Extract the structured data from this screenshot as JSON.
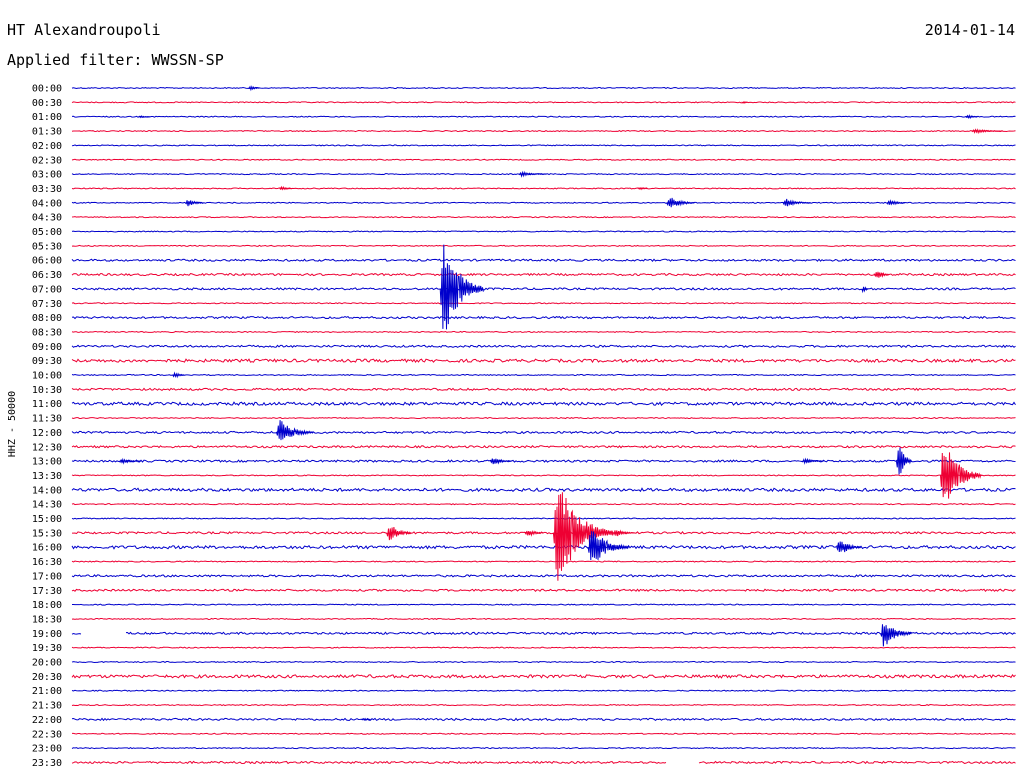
{
  "header": {
    "station": "HT Alexandroupoli",
    "date": "2014-01-14",
    "filter_text": "Applied filter: WWSSN-SP"
  },
  "chart_data": {
    "type": "seismogram",
    "ylabel": "HHZ - 50000",
    "colors": [
      "#0000cc",
      "#ee0033"
    ],
    "rows": [
      "00:00",
      "00:30",
      "01:00",
      "01:30",
      "02:00",
      "02:30",
      "03:00",
      "03:30",
      "04:00",
      "04:30",
      "05:00",
      "05:30",
      "06:00",
      "06:30",
      "07:00",
      "07:30",
      "08:00",
      "08:30",
      "09:00",
      "09:30",
      "10:00",
      "10:30",
      "11:00",
      "11:30",
      "12:00",
      "12:30",
      "13:00",
      "13:30",
      "14:00",
      "14:30",
      "15:00",
      "15:30",
      "16:00",
      "16:30",
      "17:00",
      "17:30",
      "18:00",
      "18:30",
      "19:00",
      "19:30",
      "20:00",
      "20:30",
      "21:00",
      "21:30",
      "22:00",
      "22:30",
      "23:00",
      "23:30"
    ],
    "row_noise": [
      1,
      1,
      1,
      1,
      1,
      1,
      1,
      1,
      1,
      1,
      1,
      1,
      2,
      2,
      2,
      1,
      2,
      1,
      2,
      3,
      1,
      2,
      3,
      1,
      2,
      2,
      2,
      1,
      3,
      1,
      1,
      2,
      3,
      1,
      2,
      2,
      1,
      1,
      2,
      1,
      1,
      3,
      1,
      1,
      2,
      1,
      1,
      2
    ],
    "gaps": [
      {
        "row": 38,
        "from_min": 0.3,
        "to_min": 1.7
      },
      {
        "row": 47,
        "from_min": 18.9,
        "to_min": 19.9
      }
    ],
    "events": [
      {
        "row": 0,
        "at_min": 5.6,
        "amp": 4,
        "dur_min": 0.4
      },
      {
        "row": 1,
        "at_min": 21.3,
        "amp": 3,
        "dur_min": 0.2
      },
      {
        "row": 2,
        "at_min": 2.1,
        "amp": 2,
        "dur_min": 0.4
      },
      {
        "row": 2,
        "at_min": 28.4,
        "amp": 4,
        "dur_min": 0.4
      },
      {
        "row": 3,
        "at_min": 28.6,
        "amp": 3,
        "dur_min": 1.0
      },
      {
        "row": 6,
        "at_min": 14.2,
        "amp": 3,
        "dur_min": 0.9
      },
      {
        "row": 7,
        "at_min": 6.6,
        "amp": 4,
        "dur_min": 0.4
      },
      {
        "row": 7,
        "at_min": 18.0,
        "amp": 4,
        "dur_min": 0.3
      },
      {
        "row": 8,
        "at_min": 3.6,
        "amp": 6,
        "dur_min": 0.6
      },
      {
        "row": 8,
        "at_min": 18.9,
        "amp": 10,
        "dur_min": 0.9
      },
      {
        "row": 8,
        "at_min": 22.6,
        "amp": 6,
        "dur_min": 0.9
      },
      {
        "row": 8,
        "at_min": 25.9,
        "amp": 5,
        "dur_min": 0.6
      },
      {
        "row": 13,
        "at_min": 25.5,
        "amp": 8,
        "dur_min": 0.5
      },
      {
        "row": 14,
        "at_min": 11.7,
        "amp": 66,
        "dur_min": 1.4
      },
      {
        "row": 14,
        "at_min": 25.1,
        "amp": 14,
        "dur_min": 0.2
      },
      {
        "row": 20,
        "at_min": 3.2,
        "amp": 6,
        "dur_min": 0.4
      },
      {
        "row": 24,
        "at_min": 6.5,
        "amp": 18,
        "dur_min": 1.2
      },
      {
        "row": 26,
        "at_min": 1.5,
        "amp": 4,
        "dur_min": 0.7
      },
      {
        "row": 26,
        "at_min": 13.3,
        "amp": 6,
        "dur_min": 0.7
      },
      {
        "row": 26,
        "at_min": 23.2,
        "amp": 4,
        "dur_min": 0.7
      },
      {
        "row": 26,
        "at_min": 26.2,
        "amp": 33,
        "dur_min": 0.5
      },
      {
        "row": 27,
        "at_min": 27.6,
        "amp": 48,
        "dur_min": 1.3
      },
      {
        "row": 31,
        "at_min": 10.0,
        "amp": 15,
        "dur_min": 0.8
      },
      {
        "row": 31,
        "at_min": 14.4,
        "amp": 6,
        "dur_min": 0.6
      },
      {
        "row": 31,
        "at_min": 17.2,
        "amp": 6,
        "dur_min": 0.7
      },
      {
        "row": 31,
        "at_min": 15.3,
        "amp": 70,
        "dur_min": 1.9
      },
      {
        "row": 32,
        "at_min": 16.4,
        "amp": 28,
        "dur_min": 1.3
      },
      {
        "row": 32,
        "at_min": 24.3,
        "amp": 14,
        "dur_min": 0.8
      },
      {
        "row": 38,
        "at_min": 25.7,
        "amp": 22,
        "dur_min": 1.0
      },
      {
        "row": 44,
        "at_min": 9.2,
        "amp": 4,
        "dur_min": 0.3
      }
    ]
  }
}
